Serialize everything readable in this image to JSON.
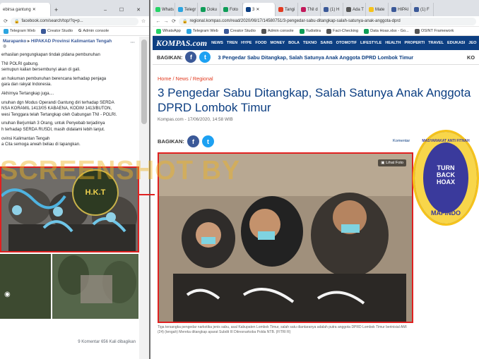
{
  "left_window": {
    "tabs": [
      {
        "label": "ebirsa gantung"
      }
    ],
    "address": "facebook.com/search/top/?q=p...",
    "bookmarks": [
      "Telegram Web",
      "Creator Studio",
      "Admin console"
    ],
    "post": {
      "breadcrumb_a": "Marapanko",
      "breadcrumb_b": "HIPAKAD Provinsi Kalimantan Tengah",
      "lines": [
        "erhasilan pengungkapan tindak pidana pembunuhan",
        "",
        "TNI POLRI gabung.",
        "semupun kalian bersembunyi akan di gali.",
        "",
        "an hukuman pembunuhan berencana terhadap penjaga",
        "gara dan rakyat Indonesia.",
        "",
        "Akhirnya Tertangkap juga....",
        "",
        "unuhan dgn Modus Operandi Gantung diri terhadap SERDA",
        "NSA KORAMIL 1413/05 KABAENA, KODIM 1413/BUTON,",
        "wesi Tenggara telah Tertangkap oleh Gabungan TNI - POLRI.",
        "",
        "unuhan Berjumlah 3 Orang, untuk Penyebab terjadinya",
        "h terhadap SERDA RUSDI, masih didalami lebih lanjut.",
        "",
        "ovinsi Kalimantan Tengah",
        "a Cita semoga arwah beliau di lapangkan."
      ],
      "logo_text": "H.K.T",
      "footer": "9 Komentar   656 Kali dibagikan"
    }
  },
  "right_window": {
    "tabs": [
      {
        "label": "Whats",
        "color": "#25d366"
      },
      {
        "label": "Telegr",
        "color": "#2ca5e0"
      },
      {
        "label": "Doku",
        "color": "#0f9d58"
      },
      {
        "label": "Foto",
        "color": "#0f9d58"
      },
      {
        "label": "3",
        "color": "#0d3f82"
      },
      {
        "label": "Tangi",
        "color": "#e23b20"
      },
      {
        "label": "TNI d",
        "color": "#c2185b"
      },
      {
        "label": "(1) H",
        "color": "#3b5998"
      },
      {
        "label": "Ada T",
        "color": "#555555"
      },
      {
        "label": "Mate",
        "color": "#f6c31a"
      },
      {
        "label": "HIPAI",
        "color": "#3b5998"
      },
      {
        "label": "(1) F",
        "color": "#3b5998"
      }
    ],
    "address": "regional.kompas.com/read/2020/06/17/14580751/3-pengedar-sabu-ditangkap-salah-satunya-anak-anggota-dprd",
    "bookmarks": [
      "WhatsApp",
      "Telegram Web",
      "Creator Studio",
      "Admin console",
      "Yudistira",
      "Fact-Checking",
      "Data Hoax.xlsx - Go...",
      "OSINT Framework"
    ],
    "site": {
      "logo": "KOMPAS.com",
      "nav": [
        "NEWS",
        "TREN",
        "HYPE",
        "FOOD",
        "MONEY",
        "BOLA",
        "TEKNO",
        "SAINS",
        "OTOMOTIF",
        "LIFESTYLE",
        "HEALTH",
        "PROPERTI",
        "TRAVEL",
        "EDUKASI",
        "JEO"
      ],
      "share_label": "BAGIKAN:",
      "share_headline": "3 Pengedar Sabu Ditangkap, Salah Satunya Anak Anggota DPRD Lombok Timur",
      "share_right": "KO",
      "breadcrumb": "Home / News / Regional",
      "title": "3 Pengedar Sabu Ditangkap, Salah Satunya Anak Anggota DPRD Lombok Timur",
      "date": "Kompas.com - 17/06/2020, 14:58 WIB",
      "share2_label": "BAGIKAN:",
      "komentar": "Komentar",
      "lihat_foto": "Lihat Foto",
      "caption": "Tiga tersangka pengedar narkotika jenis sabu, asal Kabupaten Lombok Timur, salah satu diantaranya adalah putra anggota DPRD Lombok Timur berinisial AMI (24) (tengah) Mereka ditangkap aparat Subdit III Ditresnarkoba Polda NTB. (FITRI R)"
    }
  },
  "overlay": {
    "watermark": "SCREENSHOT BY",
    "badge_top": "MASYARAKAT ANTI FITNAH",
    "badge_mid": [
      "TURN",
      "BACK",
      "HOAX"
    ],
    "badge_bottom": "MAFINDO"
  }
}
